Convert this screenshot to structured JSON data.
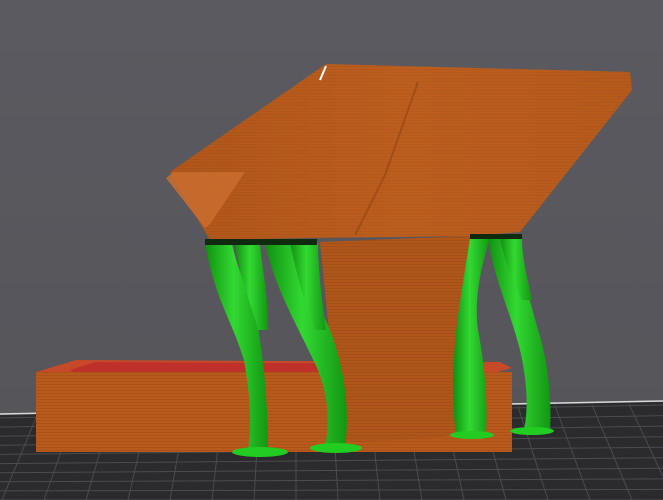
{
  "app": {
    "view": "3d-slicer-preview"
  },
  "scene": {
    "background_color": "#58585d",
    "bed_color": "#2a2a2c",
    "bed_grid_color": "#4a4a4e",
    "model_color": "#b85a1c",
    "model_highlight": "#cc6d2c",
    "model_shadow": "#8f4414",
    "infill_color": "#c0302a",
    "support_color": "#22cc22",
    "support_shadow": "#109010",
    "support_highlight": "#5cf05c"
  },
  "icons": {
    "print_bed": "print-bed-grid",
    "model": "sliced-model",
    "supports": "tree-supports"
  }
}
